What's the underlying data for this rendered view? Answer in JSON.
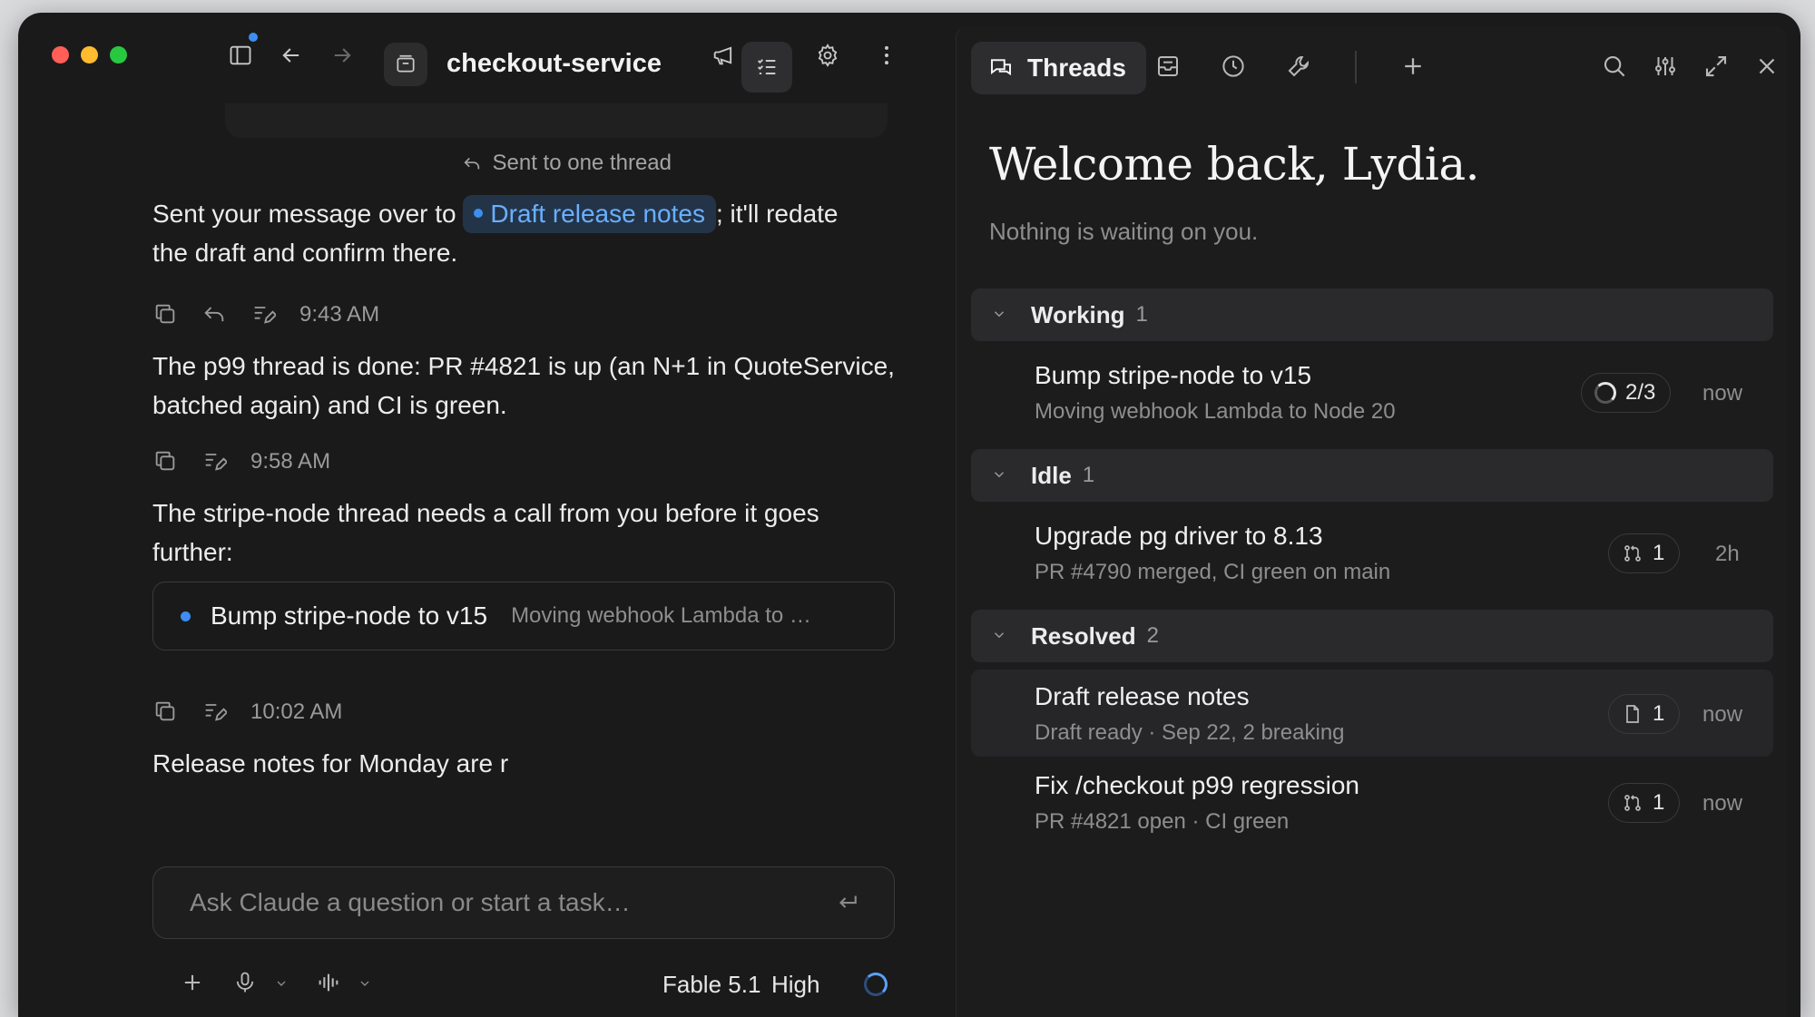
{
  "header": {
    "repo_name": "checkout-service"
  },
  "chat": {
    "sent_note": "Sent to one thread",
    "msg1_before": "Sent your message over to",
    "msg1_chip": "Draft release notes",
    "msg1_after": "; it'll redate",
    "msg1_line2": "the draft and confirm there.",
    "time1": "9:43 AM",
    "msg2": "The p99 thread is done: PR #4821 is up (an N+1 in QuoteService, batched again) and CI is green.",
    "time2": "9:58 AM",
    "msg3": "The stripe-node thread needs a call from you before it goes further:",
    "card_title": "Bump stripe-node to v15",
    "card_sub": "Moving webhook Lambda to …",
    "time3": "10:02 AM",
    "msg4": "Release notes for Monday are r"
  },
  "composer": {
    "placeholder": "Ask Claude a question or start a task…",
    "model": "Fable 5.1",
    "effort": "High"
  },
  "threads_panel": {
    "tab_label": "Threads",
    "welcome": "Welcome back, Lydia.",
    "welcome_sub": "Nothing is waiting on you.",
    "groups": [
      {
        "label": "Working",
        "count": "1",
        "items": [
          {
            "title": "Bump stripe-node to v15",
            "sub": "Moving webhook Lambda to Node 20",
            "badge": "2/3",
            "badge_icon": "progress-ring-icon",
            "time": "now"
          }
        ]
      },
      {
        "label": "Idle",
        "count": "1",
        "items": [
          {
            "title": "Upgrade pg driver to 8.13",
            "sub": "PR #4790 merged, CI green on main",
            "badge": "1",
            "badge_icon": "pull-request-icon",
            "time": "2h"
          }
        ]
      },
      {
        "label": "Resolved",
        "count": "2",
        "items": [
          {
            "title": "Draft release notes",
            "sub": "Draft ready · Sep 22, 2 breaking",
            "badge": "1",
            "badge_icon": "document-icon",
            "time": "now"
          },
          {
            "title": "Fix /checkout p99 regression",
            "sub": "PR #4821 open · CI green",
            "badge": "1",
            "badge_icon": "pull-request-icon",
            "time": "now"
          }
        ]
      }
    ]
  },
  "colors": {
    "background": "#1a1a1b",
    "accent": "#3d8ef0",
    "chip_text": "#6ab0ff"
  }
}
